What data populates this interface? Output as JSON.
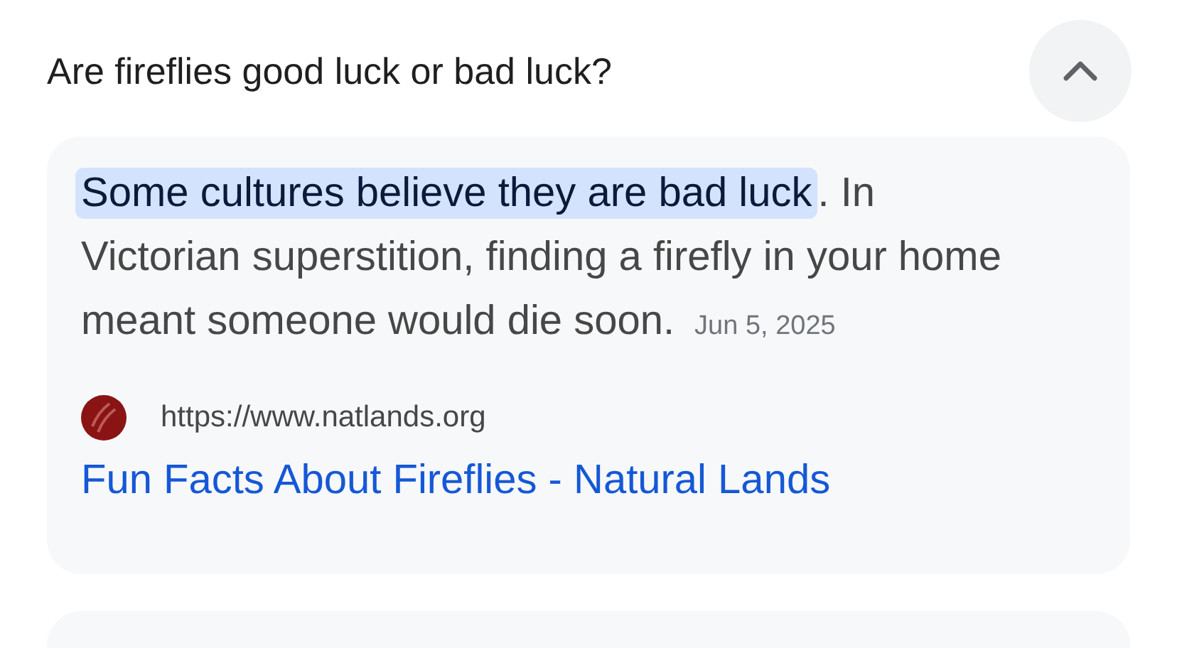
{
  "question": {
    "text": "Are fireflies good luck or bad luck?",
    "expanded": true
  },
  "answer": {
    "highlight": "Some cultures believe they are bad luck",
    "text": ". In Victorian superstition, finding a firefly in your home meant someone would die soon.",
    "date": "Jun 5, 2025"
  },
  "source": {
    "url": "https://www.natlands.org",
    "title": "Fun Facts About Fireflies - Natural Lands"
  }
}
